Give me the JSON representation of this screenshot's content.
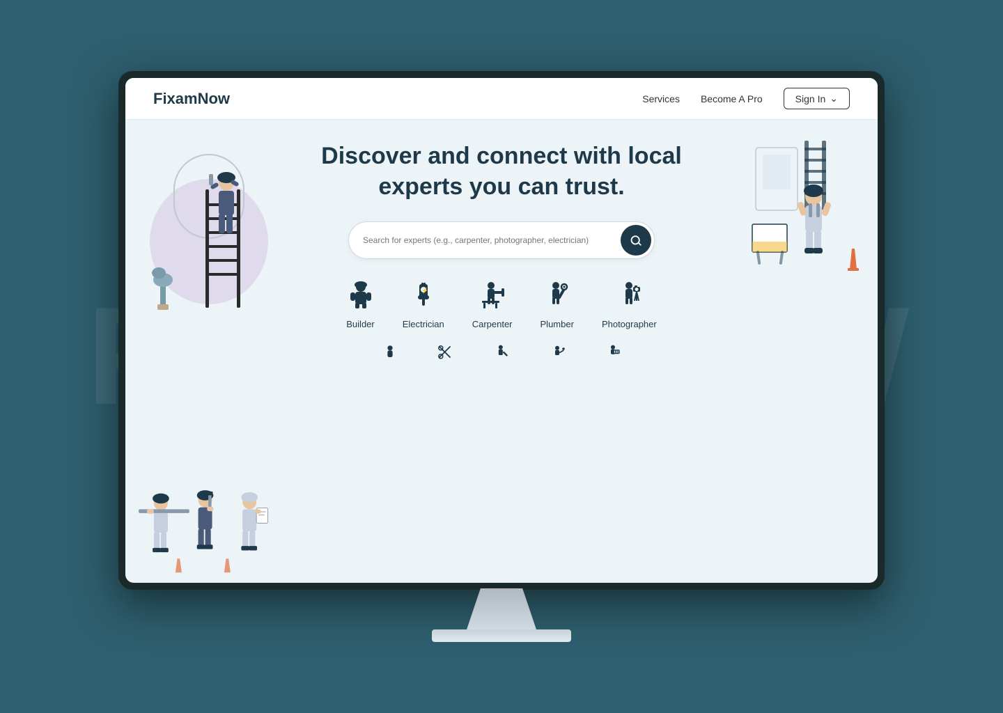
{
  "background": {
    "watermark": "FIXAMNOW"
  },
  "monitor": {
    "navbar": {
      "logo": "FixamNow",
      "links": [
        "Services",
        "Become A Pro"
      ],
      "signin_label": "Sign In"
    },
    "hero": {
      "headline_line1": "Discover and connect with local",
      "headline_line2": "experts you can trust.",
      "search_placeholder": "Search for experts (e.g., carpenter, photographer, electrician)"
    },
    "categories_row1": [
      {
        "id": "builder",
        "label": "Builder",
        "icon": "🪖"
      },
      {
        "id": "electrician",
        "label": "Electrician",
        "icon": "🔌"
      },
      {
        "id": "carpenter",
        "label": "Carpenter",
        "icon": "🪚"
      },
      {
        "id": "plumber",
        "label": "Plumber",
        "icon": "🔧"
      },
      {
        "id": "photographer",
        "label": "Photographer",
        "icon": "📷"
      }
    ],
    "categories_row2": [
      {
        "id": "tailor",
        "label": "",
        "icon": "👕"
      },
      {
        "id": "scissors",
        "label": "",
        "icon": "✂️"
      },
      {
        "id": "repair",
        "label": "",
        "icon": "🔨"
      },
      {
        "id": "welder",
        "label": "",
        "icon": "⚙️"
      },
      {
        "id": "signage",
        "label": "",
        "icon": "🪧"
      }
    ]
  }
}
